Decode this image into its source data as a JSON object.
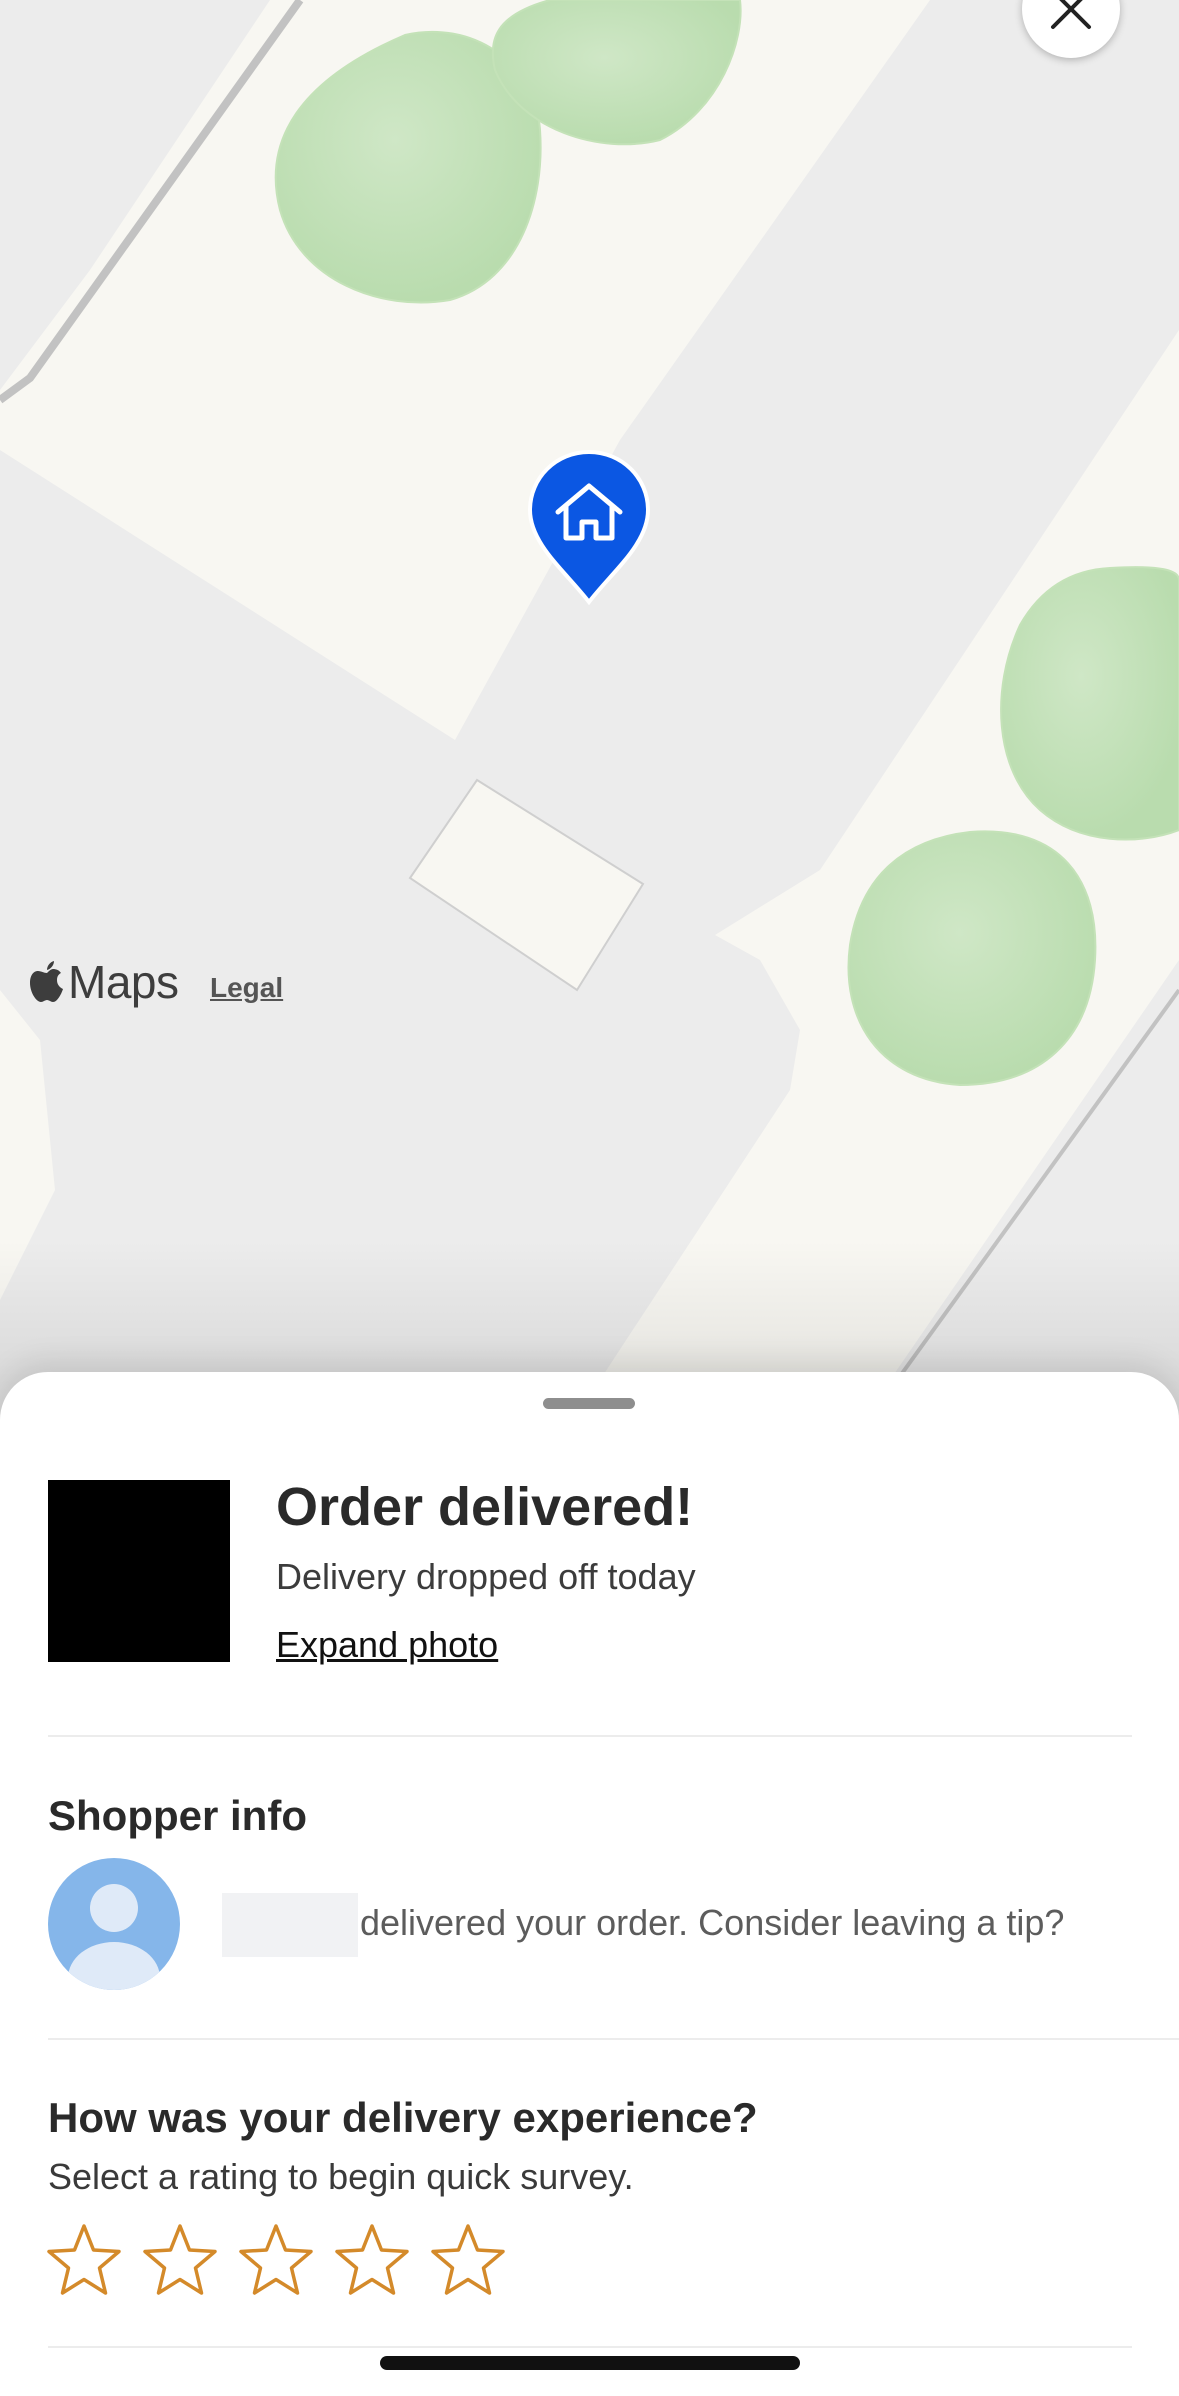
{
  "map": {
    "attribution": "Maps",
    "legal_label": "Legal",
    "icons": {
      "close": "close-icon",
      "pin": "home-pin-icon",
      "brand": "apple-logo-icon"
    },
    "pin_color": "#0b57e3"
  },
  "sheet": {
    "title": "Order delivered!",
    "subtitle": "Delivery dropped off today",
    "expand_label": "Expand photo",
    "shopper": {
      "heading": "Shopper info",
      "message": "delivered your order. Consider leaving a tip?",
      "avatar_icon": "person-avatar-icon",
      "avatar_color": "#85b6ea"
    },
    "survey": {
      "heading": "How was your delivery experience?",
      "subtitle": "Select a rating to begin quick survey.",
      "star_count": 5,
      "star_color": "#d48a2a"
    }
  }
}
